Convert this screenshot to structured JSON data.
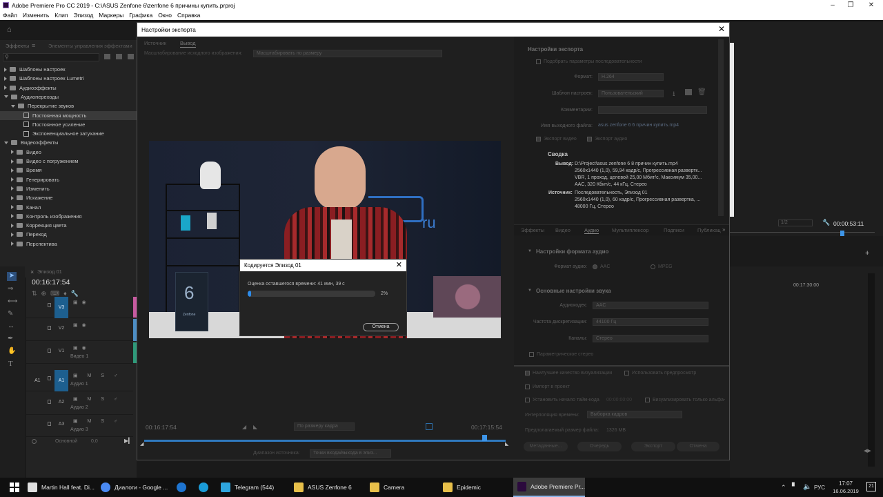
{
  "window": {
    "title": "Adobe Premiere Pro CC 2019 - C:\\ASUS Zenfone 6\\zenfone 6 причины купить.prproj"
  },
  "menu": [
    "Файл",
    "Изменить",
    "Клип",
    "Эпизод",
    "Маркеры",
    "Графика",
    "Окно",
    "Справка"
  ],
  "effects_panel": {
    "tabs": [
      "Эффекты",
      "Элементы управления эффектами"
    ],
    "tree": [
      {
        "label": "Шаблоны настроек",
        "type": "folder",
        "level": 0
      },
      {
        "label": "Шаблоны настроек Lumetri",
        "type": "folder",
        "level": 0
      },
      {
        "label": "Аудиоэффекты",
        "type": "folder",
        "level": 0
      },
      {
        "label": "Аудиопереходы",
        "type": "folder",
        "level": 0,
        "open": true
      },
      {
        "label": "Перекрытие звуков",
        "type": "folder",
        "level": 1,
        "open": true
      },
      {
        "label": "Постоянная мощность",
        "type": "fx",
        "level": 2,
        "selected": true
      },
      {
        "label": "Постоянное усиление",
        "type": "fx",
        "level": 2
      },
      {
        "label": "Экспоненциальное затухание",
        "type": "fx",
        "level": 2
      },
      {
        "label": "Видеоэффекты",
        "type": "folder",
        "level": 0,
        "open": true
      },
      {
        "label": "Видео",
        "type": "folder",
        "level": 1
      },
      {
        "label": "Видео с погружением",
        "type": "folder",
        "level": 1
      },
      {
        "label": "Время",
        "type": "folder",
        "level": 1
      },
      {
        "label": "Генерировать",
        "type": "folder",
        "level": 1
      },
      {
        "label": "Изменить",
        "type": "folder",
        "level": 1
      },
      {
        "label": "Искажение",
        "type": "folder",
        "level": 1
      },
      {
        "label": "Канал",
        "type": "folder",
        "level": 1
      },
      {
        "label": "Контроль изображения",
        "type": "folder",
        "level": 1
      },
      {
        "label": "Коррекция цвета",
        "type": "folder",
        "level": 1
      },
      {
        "label": "Переход",
        "type": "folder",
        "level": 1
      },
      {
        "label": "Перспектива",
        "type": "folder",
        "level": 1
      }
    ]
  },
  "timeline": {
    "tab": "Эпизод 01",
    "timecode": "00:16:17:54",
    "right_timecode": "00:17:30:00",
    "tracks": [
      {
        "id": "V3",
        "name": ""
      },
      {
        "id": "V2",
        "name": ""
      },
      {
        "id": "V1",
        "name": "Видео 1"
      },
      {
        "id": "A1",
        "name": "Аудио 1"
      },
      {
        "id": "A2",
        "name": "Аудио 2"
      },
      {
        "id": "A3",
        "name": "Аудио 3"
      }
    ],
    "master_label": "Основной",
    "master_value": "0,0"
  },
  "program_monitor": {
    "fit": "1/2",
    "timecode": "00:00:53:11"
  },
  "export_dialog": {
    "title": "Настройки экспорта",
    "tabs": [
      "Источник",
      "Вывод"
    ],
    "scale_label": "Масштабирование исходного изображения:",
    "scale_value": "Масштабировать по размеру",
    "start_timecode": "00:16:17:54",
    "end_timecode": "00:17:15:54",
    "fit_value": "По размеру кадра",
    "range_label": "Диапазон источника:",
    "range_value": "Точки входа/выхода в эпиз...",
    "watermark": "ru",
    "phone_number": "6",
    "phone_brand": "Zenfone",
    "settings": {
      "header": "Настройки экспорта",
      "match_label": "Подобрать параметры последовательности",
      "format_label": "Формат:",
      "format_value": "H.264",
      "preset_label": "Шаблон настроек:",
      "preset_value": "Пользовательский",
      "comment_label": "Комментарии:",
      "output_label": "Имя выходного файла:",
      "output_value": "asus zenfone 6 6 причин купить.mp4",
      "export_video": "Экспорт видео",
      "export_audio": "Экспорт аудио",
      "summary_header": "Сводка",
      "output_key": "Вывод:",
      "output_lines": [
        "D:\\Project\\asus zenfone 6 8 причин купить.mp4",
        "2560x1440 (1,0), 59,94 кадр/с, Прогрессивная развертк...",
        "VBR, 1 проход, целевой 25,00 Мбит/с, Максимум 35,00...",
        "AAC, 320 Кбит/с, 44 кГц, Стерео"
      ],
      "source_key": "Источник:",
      "source_lines": [
        "Последовательность, Эпизод 01",
        "2560x1440 (1,0), 60 кадр/с, Прогрессивная развертка, ...",
        "48000 Гц, Стерео"
      ]
    },
    "output_tabs": [
      "Эффекты",
      "Видео",
      "Аудио",
      "Мультиплексор",
      "Подписи",
      "Публикац"
    ],
    "audio_format_header": "Настройки формата аудио",
    "audio_format_label": "Формат аудио:",
    "audio_format_aac": "AAC",
    "audio_format_mpeg": "MPEG",
    "basic_audio_header": "Основные настройки звука",
    "codec_label": "Аудиокодек:",
    "codec_value": "AAC",
    "rate_label": "Частота дискретизации:",
    "rate_value": "44100 Гц",
    "channels_label": "Каналы:",
    "channels_value": "Стерео",
    "parametric_label": "Параметрическое стерео",
    "bottom": {
      "max_quality": "Наилучшее качество визуализации",
      "use_preview": "Использовать предпросмотр",
      "import_project": "Импорт в проект",
      "set_start_tc": "Установить начало тайм-кода",
      "start_tc_value": "00:00:00:00",
      "render_alpha": "Визуализировать только альфа-",
      "interp_label": "Интерполяция времени:",
      "interp_value": "Выборка кадров",
      "size_label": "Предполагаемый размер файла:",
      "size_value": "1326 MB",
      "metadata_btn": "Метаданные...",
      "queue_btn": "Очередь",
      "export_btn": "Экспорт",
      "cancel_btn": "Отмена"
    }
  },
  "progress_dialog": {
    "title": "Кодируется Эпизод 01",
    "remaining": "Оценка оставшегося времени: 41 мин, 39 с",
    "percent_text": "2%",
    "progress": 0.02,
    "cancel": "Отмена"
  },
  "taskbar": {
    "items": [
      {
        "label": "Martin Hall feat. Di...",
        "color": "#e0e0e0"
      },
      {
        "label": "Диалоги - Google ...",
        "color": "#4a8af4"
      },
      {
        "label": "",
        "color": "#1e74d0"
      },
      {
        "label": "",
        "color": "#1a9bd7"
      },
      {
        "label": "Telegram (544)",
        "color": "#2ea6df"
      },
      {
        "label": "ASUS Zenfone 6",
        "color": "#e8c04a"
      },
      {
        "label": "Camera",
        "color": "#e8c04a"
      },
      {
        "label": "Epidemic",
        "color": "#e8c04a"
      },
      {
        "label": "Adobe Premiere Pr...",
        "color": "#2b0a3d"
      }
    ],
    "lang": "РУС",
    "time": "17:07",
    "date": "16.06.2019",
    "notifications": "21"
  },
  "colors": {
    "accent": "#2d8ceb",
    "track_blue": "#1d5f8f",
    "dialog_bg": "#1f1f1f"
  }
}
